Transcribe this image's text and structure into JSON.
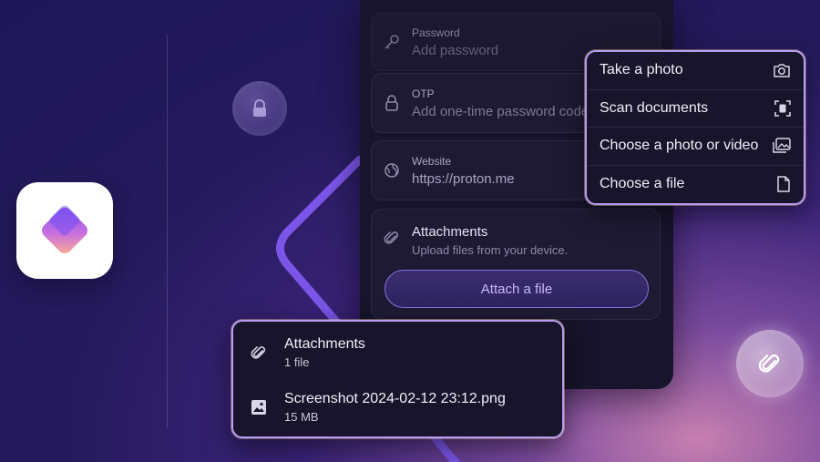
{
  "colors": {
    "background": "#1f175a",
    "panel": "#17142b",
    "accent_border": "#b89cf0",
    "button_text": "#c9b8ff"
  },
  "app_icon": {
    "name": "proton-pass-logo"
  },
  "form": {
    "password": {
      "label": "Password",
      "placeholder": "Add password",
      "icon": "key-icon"
    },
    "otp": {
      "label": "OTP",
      "placeholder": "Add one-time password code",
      "icon": "lock-icon"
    },
    "website": {
      "label": "Website",
      "value": "https://proton.me",
      "icon": "globe-icon"
    },
    "attachments": {
      "label": "Attachments",
      "subtitle": "Upload files from your device.",
      "icon": "paperclip-icon",
      "button_label": "Attach a file"
    }
  },
  "menu": {
    "items": [
      {
        "label": "Take a photo",
        "icon": "camera-icon"
      },
      {
        "label": "Scan documents",
        "icon": "scan-document-icon"
      },
      {
        "label": "Choose a photo or video",
        "icon": "gallery-icon"
      },
      {
        "label": "Choose a file",
        "icon": "file-icon"
      }
    ]
  },
  "attachments_card": {
    "title": "Attachments",
    "count": "1 file",
    "file_name": "Screenshot 2024-02-12 23:12.png",
    "file_size": "15 MB"
  }
}
